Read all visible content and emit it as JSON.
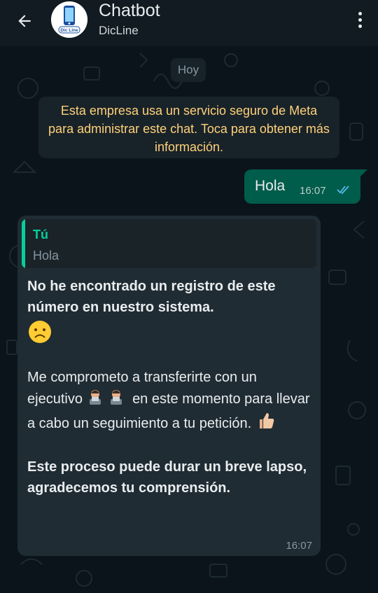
{
  "header": {
    "title": "Chatbot",
    "subtitle": "DicLine",
    "avatar_text": "Dic Line"
  },
  "chat": {
    "date_chip": "Hoy",
    "system_message": "Esta empresa usa un servicio seguro de Meta para administrar este chat. Toca para obtener más información.",
    "outgoing": {
      "text": "Hola",
      "time": "16:07",
      "status": "double-check-icon"
    },
    "incoming": {
      "quote_author": "Tú",
      "quote_text": "Hola",
      "para1": "No he encontrado un registro de este número en nuestro sistema.",
      "emoji1": "sad-face-emoji",
      "para2_a": "Me comprometo a transferirte con un ejecutivo",
      "para2_b": "en este momento para llevar a cabo un seguimiento a tu petición.",
      "emoji2": "office-worker-emoji",
      "emoji3": "thumbs-up-emoji",
      "para3": "Este proceso puede durar un breve lapso, agradecemos tu comprensión.",
      "time": "16:07"
    }
  },
  "colors": {
    "header_bg": "#111b21",
    "chat_bg": "#0b141a",
    "outgoing_bubble": "#005c4b",
    "incoming_bubble": "#202c33",
    "system_text": "#ffd279",
    "accent": "#06cf9c",
    "read_ticks": "#53bdeb"
  }
}
